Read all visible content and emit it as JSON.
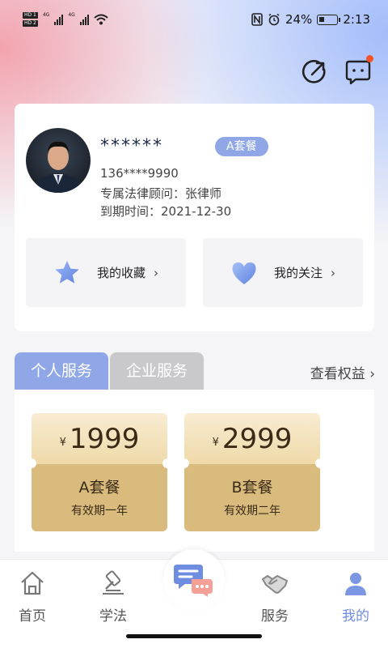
{
  "status_bar": {
    "hd1": "HD 1",
    "hd2": "HD 2",
    "net1": "4G",
    "net2": "4G",
    "battery": "24%",
    "time": "2:13"
  },
  "top_actions": {
    "share_icon": "share-arrow-icon",
    "message_icon": "chat-bubble-icon"
  },
  "profile": {
    "username": "******",
    "plan_badge": "A套餐",
    "phone": "136****9990",
    "advisor": "专属法律顾问：张律师",
    "expiry": "到期时间：2021-12-30"
  },
  "quick_links": {
    "favorites": {
      "label": "我的收藏",
      "icon": "star-icon"
    },
    "following": {
      "label": "我的关注",
      "icon": "heart-icon"
    }
  },
  "services": {
    "tabs": [
      {
        "label": "个人服务",
        "active": true
      },
      {
        "label": "企业服务",
        "active": false
      }
    ],
    "view_benefits": "查看权益",
    "packages": [
      {
        "currency": "¥",
        "price": "1999",
        "name": "A套餐",
        "validity": "有效期一年"
      },
      {
        "currency": "¥",
        "price": "2999",
        "name": "B套餐",
        "validity": "有效期二年"
      }
    ]
  },
  "bottom_nav": {
    "items": [
      {
        "label": "首页",
        "icon": "home-icon",
        "active": false
      },
      {
        "label": "学法",
        "icon": "gavel-icon",
        "active": false
      },
      {
        "label": "",
        "icon": "chat-center-icon",
        "active": false
      },
      {
        "label": "服务",
        "icon": "handshake-icon",
        "active": false
      },
      {
        "label": "我的",
        "icon": "person-icon",
        "active": true
      }
    ]
  },
  "colors": {
    "accent": "#8fa7e6",
    "nav_active": "#6f8de0",
    "gold_light": "#f8ecd2",
    "gold_dark": "#d9bb7d",
    "badge_dot": "#f2532b"
  }
}
